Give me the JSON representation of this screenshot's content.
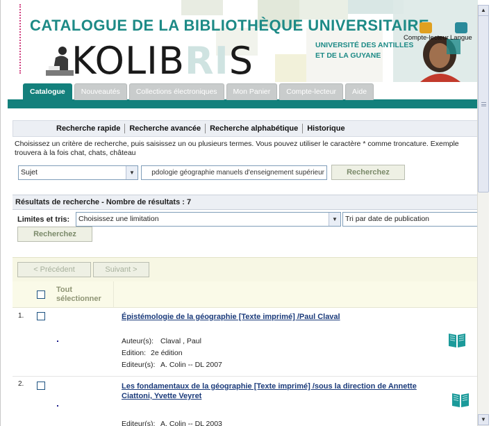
{
  "header": {
    "title": "CATALOGUE DE LA BIBLIOTHÈQUE UNIVERSITAIRE",
    "logo_pre": "KOLIB",
    "logo_mid": "RI",
    "logo_post": "S",
    "univ_line1": "UNIVERSITÉ DES ANTILLES",
    "univ_line2": "ET DE LA GUYANE",
    "compte_lecteur": "Compte-lecteur",
    "langue": "Langue"
  },
  "tabs": [
    "Catalogue",
    "Nouveautés",
    "Collections électroniques",
    "Mon Panier",
    "Compte-lecteur",
    "Aide"
  ],
  "search_nav": [
    "Recherche rapide",
    "Recherche avancée",
    "Recherche alphabétique",
    "Historique"
  ],
  "search": {
    "help_line1": "Choisissez un critère de recherche, puis saisissez un ou plusieurs termes. Vous pouvez utiliser le caractère * comme troncature. Exemple",
    "help_line2": "trouvera à la fois chat, chats, château",
    "field_select": "Sujet",
    "query_value": "pdologie géographie manuels d'enseignement supérieur",
    "button": "Recherchez"
  },
  "results": {
    "header": "Résultats de recherche - Nombre de résultats : 7",
    "limits_label": "Limites et tris:",
    "limit_select": "Choisissez une limitation",
    "sort_select": "Tri par date de publication",
    "button": "Recherchez",
    "prev": "< Précédent",
    "next": "Suivant >",
    "select_all_1": "Tout",
    "select_all_2": "sélectionner"
  },
  "records": [
    {
      "num": "1.",
      "title": "Épistémologie de la géographie [Texte imprimé] /Paul Claval",
      "fields": [
        {
          "label": "Auteur(s):",
          "value": "Claval , Paul"
        },
        {
          "label": "Edition:",
          "value": "2e édition"
        },
        {
          "label": "Editeur(s):",
          "value": "A. Colin -- DL 2007"
        }
      ]
    },
    {
      "num": "2.",
      "title": "Les fondamentaux de la géographie [Texte imprimé] /sous la direction de Annette Ciattoni, Yvette Veyret",
      "fields": [
        {
          "label": "Editeur(s):",
          "value": "A. Colin -- DL 2003"
        }
      ]
    }
  ],
  "colors": {
    "brand_teal": "#13807c",
    "title_teal": "#1d8a86",
    "link_blue": "#1a3a7a",
    "book_icon": "#1b9a9a"
  }
}
